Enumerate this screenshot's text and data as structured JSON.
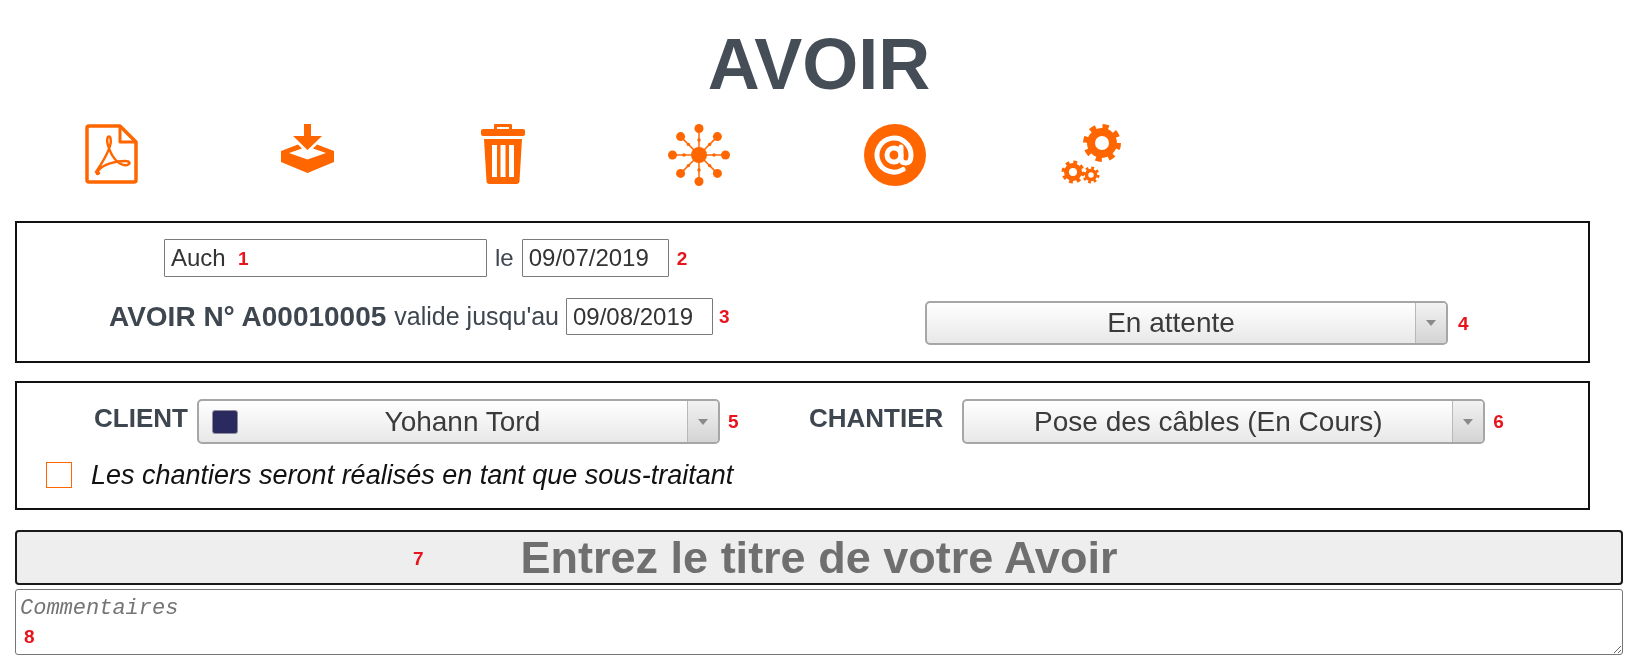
{
  "title": "AVOIR",
  "header_panel": {
    "place": {
      "value": "Auch",
      "marker": "1"
    },
    "date_prefix": "le",
    "date": {
      "value": "09/07/2019",
      "marker": "2"
    },
    "number": "AVOIR N° A00010005",
    "validity_label": "valide jusqu'au",
    "validity_date": {
      "value": "09/08/2019",
      "marker": "3"
    },
    "status": {
      "value": "En attente",
      "marker": "4"
    }
  },
  "client_panel": {
    "client": {
      "label": "CLIENT",
      "value": "Yohann Tord",
      "color": "#2b2a5e",
      "marker": "5"
    },
    "site": {
      "label": "CHANTIER",
      "value": "Pose des câbles (En Cours)",
      "marker": "6"
    },
    "subcontractor": {
      "label": "Les chantiers seront réalisés en tant que sous-traitant",
      "checked": false
    }
  },
  "title_field": {
    "placeholder": "Entrez le titre de votre Avoir",
    "marker": "7"
  },
  "comments": {
    "placeholder": "Commentaires",
    "marker": "8"
  }
}
